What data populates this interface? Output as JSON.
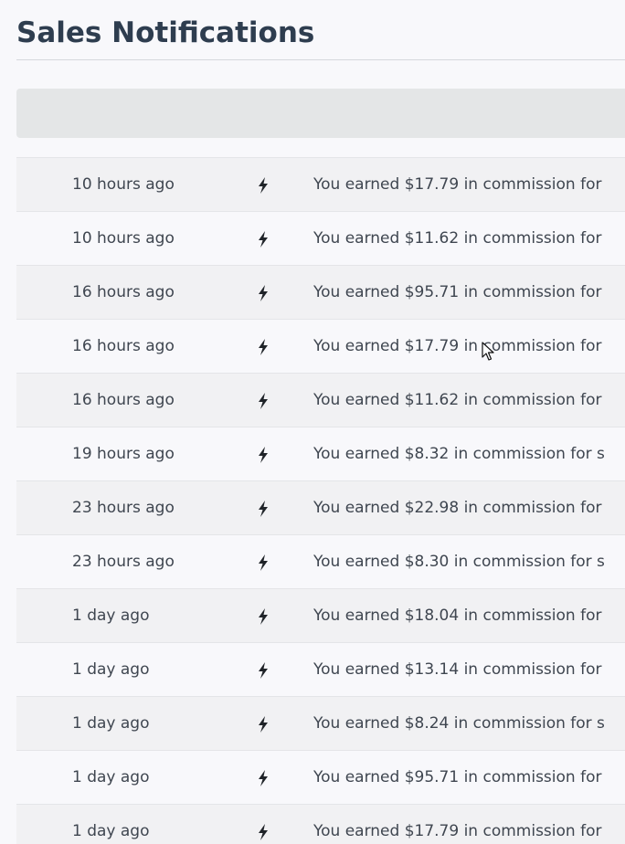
{
  "page": {
    "title": "Sales Notifications"
  },
  "notifications": [
    {
      "time": "10 hours ago",
      "message": "You earned $17.79 in commission for",
      "icon": "bolt-icon"
    },
    {
      "time": "10 hours ago",
      "message": "You earned $11.62 in commission for",
      "icon": "bolt-icon"
    },
    {
      "time": "16 hours ago",
      "message": "You earned $95.71 in commission for",
      "icon": "bolt-icon"
    },
    {
      "time": "16 hours ago",
      "message": "You earned $17.79 in commission for",
      "icon": "bolt-icon"
    },
    {
      "time": "16 hours ago",
      "message": "You earned $11.62 in commission for",
      "icon": "bolt-icon"
    },
    {
      "time": "19 hours ago",
      "message": "You earned $8.32 in commission for s",
      "icon": "bolt-icon"
    },
    {
      "time": "23 hours ago",
      "message": "You earned $22.98 in commission for",
      "icon": "bolt-icon"
    },
    {
      "time": "23 hours ago",
      "message": "You earned $8.30 in commission for s",
      "icon": "bolt-icon"
    },
    {
      "time": "1 day ago",
      "message": "You earned $18.04 in commission for",
      "icon": "bolt-icon"
    },
    {
      "time": "1 day ago",
      "message": "You earned $13.14 in commission for",
      "icon": "bolt-icon"
    },
    {
      "time": "1 day ago",
      "message": "You earned $8.24 in commission for s",
      "icon": "bolt-icon"
    },
    {
      "time": "1 day ago",
      "message": "You earned $95.71 in commission for",
      "icon": "bolt-icon"
    },
    {
      "time": "1 day ago",
      "message": "You earned $17.79 in commission for",
      "icon": "bolt-icon"
    }
  ],
  "colors": {
    "title": "#2e3d4f",
    "text": "#3f4650",
    "header_bar": "#e4e6e7",
    "row_alt": "#f1f1f3",
    "background": "#f8f8fb"
  }
}
